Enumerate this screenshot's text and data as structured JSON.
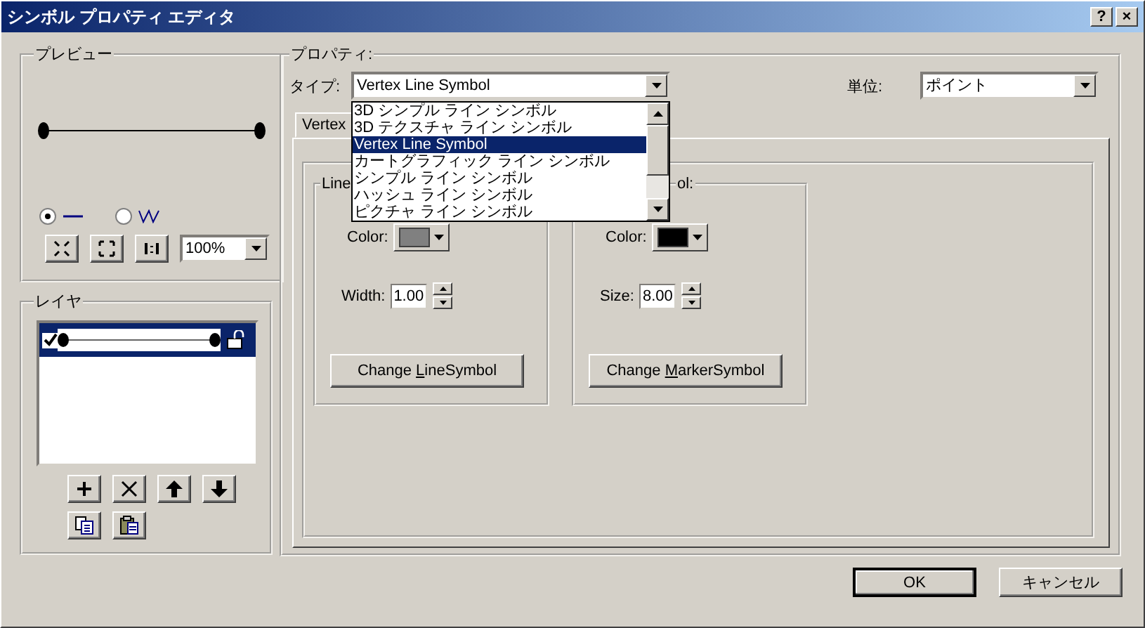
{
  "window": {
    "title": "シンボル プロパティ エディタ",
    "buttons": [
      "?",
      "×"
    ]
  },
  "preview": {
    "title": "プレビュー",
    "modes": [
      {
        "kind": "line",
        "selected": true
      },
      {
        "kind": "zigzag",
        "selected": false
      }
    ],
    "zoom": "100%"
  },
  "layers": {
    "title": "レイヤ",
    "items": [
      {
        "checked": true,
        "selected": true
      }
    ]
  },
  "properties": {
    "title": "プロパティ:",
    "type_label": "タイプ:",
    "type_value": "Vertex Line Symbol",
    "unit_label": "単位:",
    "unit_value": "ポイント",
    "type_options": [
      {
        "label": "3D シンプル ライン シンボル",
        "selected": false
      },
      {
        "label": "3D テクスチャ ライン シンボル",
        "selected": false
      },
      {
        "label": "Vertex Line Symbol",
        "selected": true
      },
      {
        "label": "カートグラフィック ライン シンボル",
        "selected": false
      },
      {
        "label": "シンプル ライン シンボル",
        "selected": false
      },
      {
        "label": "ハッシュ ライン シンボル",
        "selected": false
      },
      {
        "label": "ピクチャ ライン シンボル",
        "selected": false
      }
    ],
    "tab": "Vertex",
    "groups": [
      {
        "title": "Line",
        "color_label": "Color:",
        "color": "#808080",
        "value_label": "Width:",
        "value": "1.00",
        "button": {
          "before": "Change ",
          "key": "L",
          "after": "ineSymbol"
        }
      },
      {
        "title": "ol:",
        "color_label": "Color:",
        "color": "#000000",
        "value_label": "Size:",
        "value": "8.00",
        "button": {
          "before": "Change ",
          "key": "M",
          "after": "arkerSymbol"
        }
      }
    ]
  },
  "buttons": [
    {
      "label": "OK",
      "default": true
    },
    {
      "label": "キャンセル",
      "default": false
    }
  ]
}
